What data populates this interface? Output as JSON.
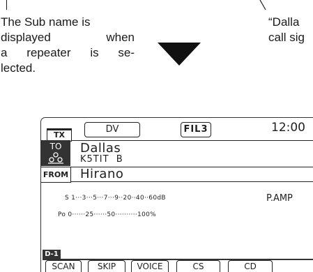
{
  "callout": {
    "left_lines": [
      "The Sub name is",
      "displayed when",
      "a repeater is se-",
      "lected."
    ],
    "right_lines": [
      "“Dalla",
      "call sig"
    ]
  },
  "radio": {
    "tx_badge": "TX",
    "mode_button": "DV",
    "filter_button": "FIL3",
    "clock": "12:00",
    "to": {
      "label": "TO",
      "name": "Dallas",
      "callsign": "K5TIT  B"
    },
    "from": {
      "label": "FROM",
      "name": "Hirano"
    },
    "s_meter_scale": "S 1···3···5···7···9··20··40··60dB",
    "po_meter_scale": "Po 0······25······50··········100%",
    "preamp": "P.AMP",
    "memory_tag": "D-1",
    "softkeys": [
      "SCAN",
      "SKIP",
      "VOICE",
      "CS",
      "CD"
    ]
  },
  "colors": {
    "lcd_ink": "#222222",
    "arrow": "#111111"
  },
  "icons": [
    "down-arrow-icon",
    "group-icon"
  ]
}
